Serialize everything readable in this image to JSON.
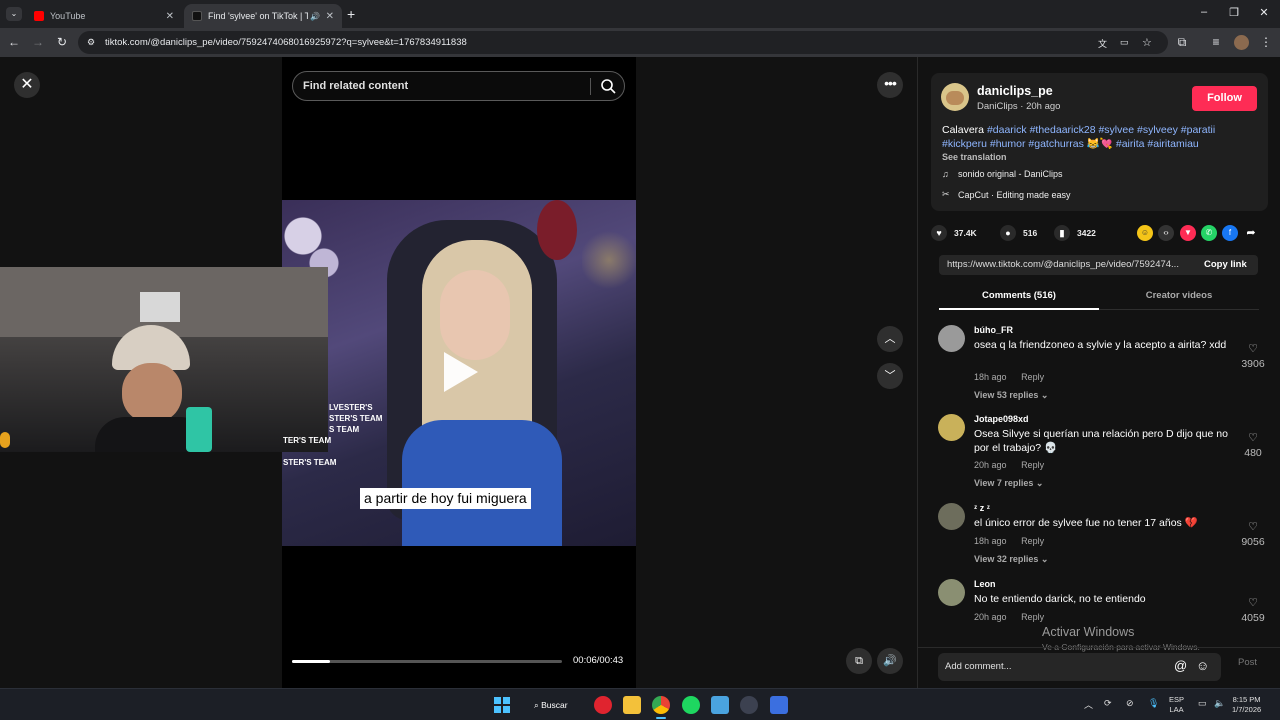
{
  "browser": {
    "tabs": [
      {
        "title": "YouTube",
        "favicon_color": "#ff0000"
      },
      {
        "title": "Find 'sylvee' on TikTok | Tik",
        "favicon_color": "#111111"
      }
    ],
    "new_tab": "+",
    "url": "tiktok.com/@daniclips_pe/video/7592474068016925972?q=sylvee&t=1767834911838"
  },
  "player": {
    "search_placeholder": "Find related content",
    "caption": "a partir de hoy fui miguera",
    "overlay_lines": [
      "LVESTER'S",
      "STER'S TEAM",
      "S TEAM",
      "TER'S TEAM",
      "STER'S TEAM"
    ],
    "current_time": "00:06",
    "duration": "00:43",
    "time_display": "00:06/00:43",
    "progress": 0.14
  },
  "post": {
    "author_username": "daniclips_pe",
    "author_sub": "DaniClips · 20h ago",
    "follow_label": "Follow",
    "caption_plain": "Calavera",
    "hashtags": [
      "#daarick",
      "#thedaarick28",
      "#sylvee",
      "#sylveey",
      "#paratii",
      "#kickperu",
      "#humor",
      "#gatchurras",
      "#airita",
      "#airitamiau"
    ],
    "see_translation": "See translation",
    "sound": "sonido original - DaniClips",
    "capcut": "CapCut · Editing made easy",
    "likes": "37.4K",
    "comments": "516",
    "saves": "3422",
    "link": "https://www.tiktok.com/@daniclips_pe/video/7592474...",
    "copy_link_label": "Copy link"
  },
  "panel_tabs": {
    "comments": "Comments (516)",
    "creator": "Creator videos"
  },
  "comments": [
    {
      "user": "búho_FR",
      "text": "osea q la friendzoneo a sylvie y la acepto a airita? xdd",
      "time": "18h ago",
      "reply": "Reply",
      "replies": "View 53 replies",
      "likes": "3906",
      "avatar_color": "#9a9a9a"
    },
    {
      "user": "Jotape098xd",
      "text": "Osea Silvye si querían una relación pero D dijo que no por el trabajo? 💀",
      "time": "20h ago",
      "reply": "Reply",
      "replies": "View 7 replies",
      "likes": "480",
      "avatar_color": "#c9b15a"
    },
    {
      "user": "ᶻ z ᶻ",
      "text": "el único error de sylvee fue no tener 17 años 💔",
      "time": "18h ago",
      "reply": "Reply",
      "replies": "View 32 replies",
      "likes": "9056",
      "avatar_color": "#6d6d5c"
    },
    {
      "user": "Leon",
      "text": "No te entiendo darick, no te entiendo",
      "time": "20h ago",
      "reply": "Reply",
      "replies": "",
      "likes": "4059",
      "avatar_color": "#8a8f72"
    }
  ],
  "add_comment_placeholder": "Add comment...",
  "post_label": "Post",
  "windows_activation": {
    "title": "Activar Windows",
    "subtitle": "Ve a Configuración para activar Windows."
  },
  "taskbar": {
    "search_label": "Buscar",
    "lang_top": "ESP",
    "lang_bottom": "LAA",
    "time": "8:15 PM",
    "date": "1/7/2026"
  }
}
